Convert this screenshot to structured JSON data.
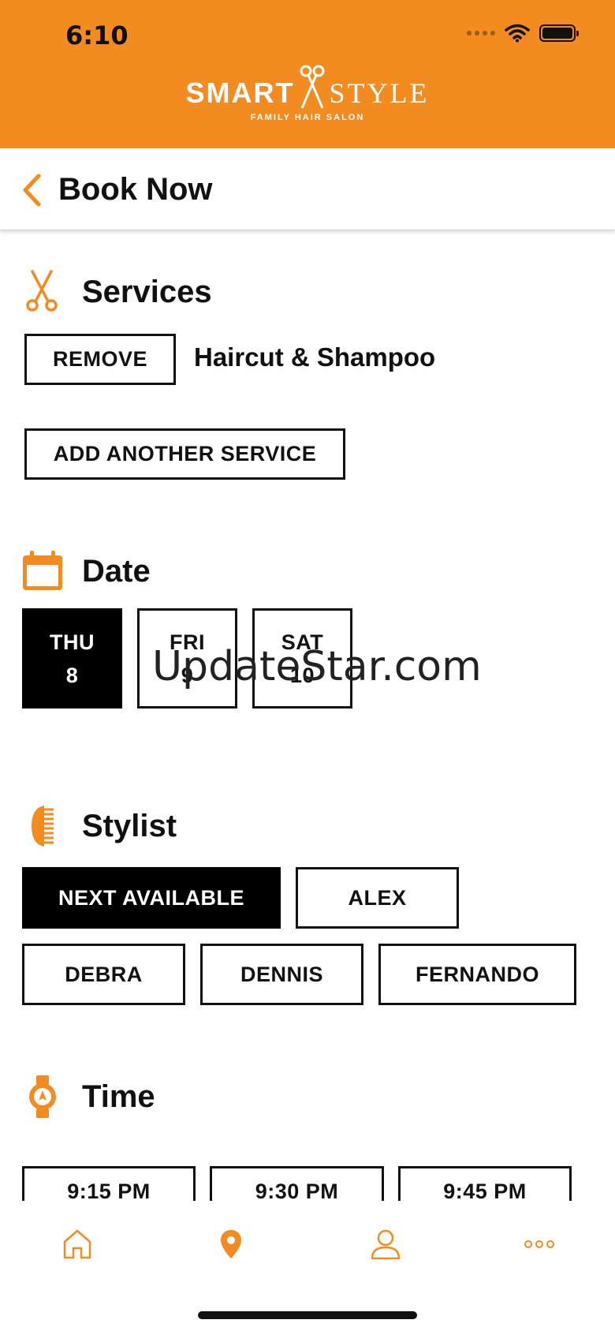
{
  "status_bar": {
    "time": "6:10"
  },
  "brand": {
    "name_left": "SMART",
    "name_right": "STYLE",
    "tagline": "FAMILY HAIR SALON",
    "accent_color": "#f28b20"
  },
  "nav": {
    "title": "Book Now",
    "back_icon": "chevron-left-icon"
  },
  "services": {
    "title": "Services",
    "icon": "scissors-icon",
    "remove_label": "REMOVE",
    "selected_service": "Haircut & Shampoo",
    "add_label": "ADD ANOTHER SERVICE"
  },
  "date": {
    "title": "Date",
    "icon": "calendar-icon",
    "days": [
      {
        "day": "THU",
        "num": "8",
        "selected": true
      },
      {
        "day": "FRI",
        "num": "9",
        "selected": false
      },
      {
        "day": "SAT",
        "num": "10",
        "selected": false
      }
    ]
  },
  "stylist": {
    "title": "Stylist",
    "icon": "comb-icon",
    "options": [
      {
        "label": "NEXT AVAILABLE",
        "selected": true
      },
      {
        "label": "ALEX",
        "selected": false
      },
      {
        "label": "DEBRA",
        "selected": false
      },
      {
        "label": "DENNIS",
        "selected": false
      },
      {
        "label": "FERNANDO",
        "selected": false
      }
    ]
  },
  "time": {
    "title": "Time",
    "icon": "watch-icon",
    "slots": [
      "9:15 PM",
      "9:30 PM",
      "9:45 PM"
    ]
  },
  "tabbar": {
    "tabs": [
      {
        "name": "home-icon"
      },
      {
        "name": "location-pin-icon",
        "active": true
      },
      {
        "name": "profile-icon"
      },
      {
        "name": "more-icon"
      }
    ]
  },
  "watermark": "UpdateStar.com"
}
